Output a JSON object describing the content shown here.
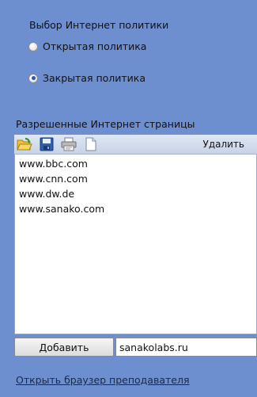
{
  "policy": {
    "title": "Выбор Интернет политики",
    "options": [
      {
        "label": "Открытая политика",
        "checked": false
      },
      {
        "label": "Закрытая политика",
        "checked": true
      }
    ]
  },
  "allowed": {
    "title": "Разрешенные Интернет страницы",
    "toolbar": {
      "icons": [
        "open-folder-icon",
        "save-icon",
        "print-icon",
        "new-document-icon"
      ],
      "delete_label": "Удалить"
    },
    "items": [
      "www.bbc.com",
      "www.cnn.com",
      "www.dw.de",
      "www.sanako.com"
    ]
  },
  "add": {
    "button_label": "Добавить",
    "input_value": "sanakolabs.ru"
  },
  "footer": {
    "link_label": "Открыть браузер преподавателя"
  },
  "colors": {
    "background": "#6d8fd0",
    "toolbar": "#d3dcec"
  }
}
